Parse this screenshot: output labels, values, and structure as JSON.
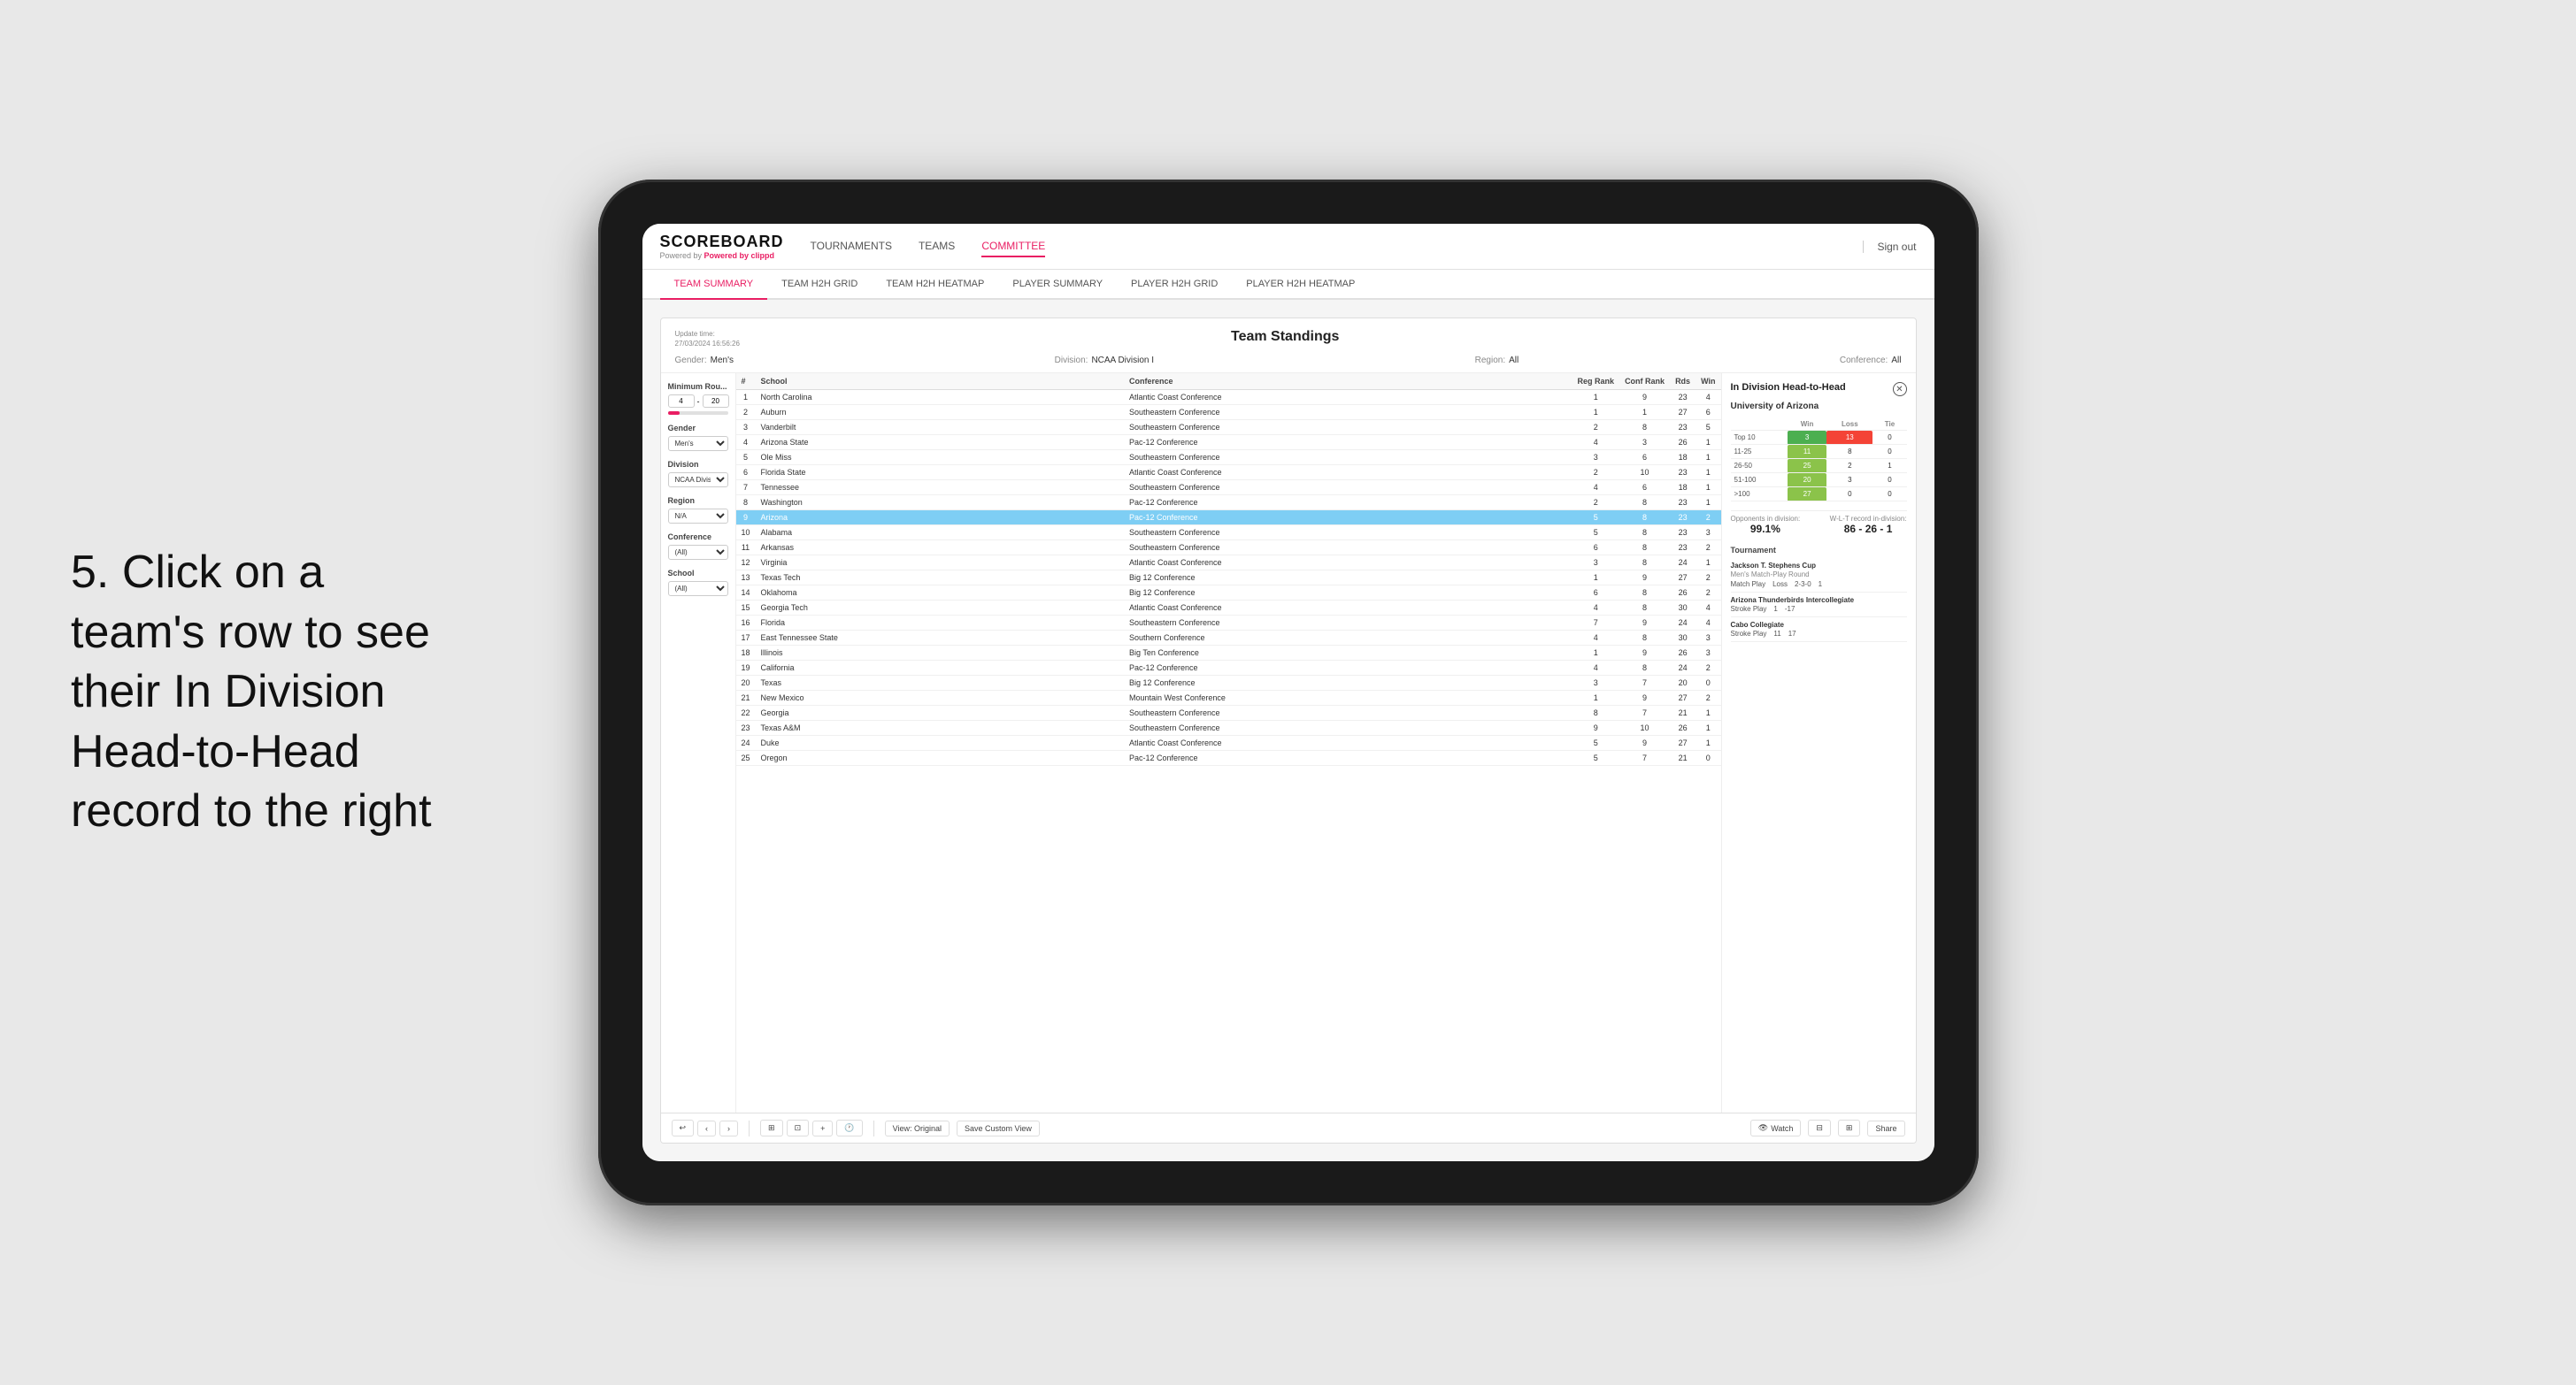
{
  "annotation": {
    "text": "5. Click on a team's row to see their In Division Head-to-Head record to the right"
  },
  "header": {
    "logo_top": "SCOREBOARD",
    "logo_bottom": "Powered by clippd",
    "nav": [
      {
        "label": "TOURNAMENTS",
        "active": false
      },
      {
        "label": "TEAMS",
        "active": false
      },
      {
        "label": "COMMITTEE",
        "active": true
      }
    ],
    "sign_out": "Sign out"
  },
  "sub_nav": [
    {
      "label": "TEAM SUMMARY",
      "active": true
    },
    {
      "label": "TEAM H2H GRID",
      "active": false
    },
    {
      "label": "TEAM H2H HEATMAP",
      "active": false
    },
    {
      "label": "PLAYER SUMMARY",
      "active": false
    },
    {
      "label": "PLAYER H2H GRID",
      "active": false
    },
    {
      "label": "PLAYER H2H HEATMAP",
      "active": false
    }
  ],
  "panel": {
    "title": "Team Standings",
    "update_time": "Update time:\n27/03/2024 16:56:26",
    "gender_label": "Gender:",
    "gender_value": "Men's",
    "division_label": "Division:",
    "division_value": "NCAA Division I",
    "region_label": "Region:",
    "region_value": "All",
    "conference_label": "Conference:",
    "conference_value": "All"
  },
  "filters": {
    "min_rounds_label": "Minimum Rou...",
    "min_rounds_min": "4",
    "min_rounds_max": "20",
    "gender_label": "Gender",
    "gender_value": "Men's",
    "division_label": "Division",
    "division_value": "NCAA Division I",
    "region_label": "Region",
    "region_value": "N/A",
    "conference_label": "Conference",
    "conference_value": "(All)",
    "school_label": "School",
    "school_value": "(All)"
  },
  "table": {
    "headers": [
      "#",
      "School",
      "Conference",
      "Reg Rank",
      "Conf Rank",
      "Rds",
      "Win"
    ],
    "rows": [
      {
        "rank": "1",
        "school": "North Carolina",
        "conference": "Atlantic Coast Conference",
        "reg": "1",
        "conf": "9",
        "rds": "23",
        "win": "4"
      },
      {
        "rank": "2",
        "school": "Auburn",
        "conference": "Southeastern Conference",
        "reg": "1",
        "conf": "1",
        "rds": "27",
        "win": "6"
      },
      {
        "rank": "3",
        "school": "Vanderbilt",
        "conference": "Southeastern Conference",
        "reg": "2",
        "conf": "8",
        "rds": "23",
        "win": "5"
      },
      {
        "rank": "4",
        "school": "Arizona State",
        "conference": "Pac-12 Conference",
        "reg": "4",
        "conf": "3",
        "rds": "26",
        "win": "1"
      },
      {
        "rank": "5",
        "school": "Ole Miss",
        "conference": "Southeastern Conference",
        "reg": "3",
        "conf": "6",
        "rds": "18",
        "win": "1"
      },
      {
        "rank": "6",
        "school": "Florida State",
        "conference": "Atlantic Coast Conference",
        "reg": "2",
        "conf": "10",
        "rds": "23",
        "win": "1"
      },
      {
        "rank": "7",
        "school": "Tennessee",
        "conference": "Southeastern Conference",
        "reg": "4",
        "conf": "6",
        "rds": "18",
        "win": "1"
      },
      {
        "rank": "8",
        "school": "Washington",
        "conference": "Pac-12 Conference",
        "reg": "2",
        "conf": "8",
        "rds": "23",
        "win": "1"
      },
      {
        "rank": "9",
        "school": "Arizona",
        "conference": "Pac-12 Conference",
        "reg": "5",
        "conf": "8",
        "rds": "23",
        "win": "2",
        "selected": true
      },
      {
        "rank": "10",
        "school": "Alabama",
        "conference": "Southeastern Conference",
        "reg": "5",
        "conf": "8",
        "rds": "23",
        "win": "3"
      },
      {
        "rank": "11",
        "school": "Arkansas",
        "conference": "Southeastern Conference",
        "reg": "6",
        "conf": "8",
        "rds": "23",
        "win": "2"
      },
      {
        "rank": "12",
        "school": "Virginia",
        "conference": "Atlantic Coast Conference",
        "reg": "3",
        "conf": "8",
        "rds": "24",
        "win": "1"
      },
      {
        "rank": "13",
        "school": "Texas Tech",
        "conference": "Big 12 Conference",
        "reg": "1",
        "conf": "9",
        "rds": "27",
        "win": "2"
      },
      {
        "rank": "14",
        "school": "Oklahoma",
        "conference": "Big 12 Conference",
        "reg": "6",
        "conf": "8",
        "rds": "26",
        "win": "2"
      },
      {
        "rank": "15",
        "school": "Georgia Tech",
        "conference": "Atlantic Coast Conference",
        "reg": "4",
        "conf": "8",
        "rds": "30",
        "win": "4"
      },
      {
        "rank": "16",
        "school": "Florida",
        "conference": "Southeastern Conference",
        "reg": "7",
        "conf": "9",
        "rds": "24",
        "win": "4"
      },
      {
        "rank": "17",
        "school": "East Tennessee State",
        "conference": "Southern Conference",
        "reg": "4",
        "conf": "8",
        "rds": "30",
        "win": "3"
      },
      {
        "rank": "18",
        "school": "Illinois",
        "conference": "Big Ten Conference",
        "reg": "1",
        "conf": "9",
        "rds": "26",
        "win": "3"
      },
      {
        "rank": "19",
        "school": "California",
        "conference": "Pac-12 Conference",
        "reg": "4",
        "conf": "8",
        "rds": "24",
        "win": "2"
      },
      {
        "rank": "20",
        "school": "Texas",
        "conference": "Big 12 Conference",
        "reg": "3",
        "conf": "7",
        "rds": "20",
        "win": "0"
      },
      {
        "rank": "21",
        "school": "New Mexico",
        "conference": "Mountain West Conference",
        "reg": "1",
        "conf": "9",
        "rds": "27",
        "win": "2"
      },
      {
        "rank": "22",
        "school": "Georgia",
        "conference": "Southeastern Conference",
        "reg": "8",
        "conf": "7",
        "rds": "21",
        "win": "1"
      },
      {
        "rank": "23",
        "school": "Texas A&M",
        "conference": "Southeastern Conference",
        "reg": "9",
        "conf": "10",
        "rds": "26",
        "win": "1"
      },
      {
        "rank": "24",
        "school": "Duke",
        "conference": "Atlantic Coast Conference",
        "reg": "5",
        "conf": "9",
        "rds": "27",
        "win": "1"
      },
      {
        "rank": "25",
        "school": "Oregon",
        "conference": "Pac-12 Conference",
        "reg": "5",
        "conf": "7",
        "rds": "21",
        "win": "0"
      }
    ]
  },
  "h2h": {
    "title": "In Division Head-to-Head",
    "school": "University of Arizona",
    "record_headers": [
      "",
      "Win",
      "Loss",
      "Tie"
    ],
    "record_rows": [
      {
        "label": "Top 10",
        "win": "3",
        "loss": "13",
        "tie": "0",
        "win_class": "cell-green",
        "loss_class": "cell-red"
      },
      {
        "label": "11-25",
        "win": "11",
        "loss": "8",
        "tie": "0",
        "win_class": "cell-lightgreen",
        "loss_class": ""
      },
      {
        "label": "26-50",
        "win": "25",
        "loss": "2",
        "tie": "1",
        "win_class": "cell-lightgreen",
        "loss_class": ""
      },
      {
        "label": "51-100",
        "win": "20",
        "loss": "3",
        "tie": "0",
        "win_class": "cell-lightgreen",
        "loss_class": ""
      },
      {
        "label": ">100",
        "win": "27",
        "loss": "0",
        "tie": "0",
        "win_class": "cell-lightgreen",
        "loss_class": ""
      }
    ],
    "opponents_label": "Opponents in division:",
    "opponents_value": "99.1%",
    "record_label": "W-L-T record in-division:",
    "record_value": "86 - 26 - 1",
    "tournaments": [
      {
        "name": "Jackson T. Stephens Cup",
        "sub": "Men's Match-Play Round",
        "event_type": "Match Play",
        "result": "Loss",
        "pos": "2-3-0",
        "score": "1"
      },
      {
        "name": "Arizona Thunderbirds Intercollegiate",
        "sub": "",
        "event_type": "Stroke Play",
        "result": "1",
        "pos": "",
        "score": "-17"
      },
      {
        "name": "Cabo Collegiate",
        "sub": "",
        "event_type": "Stroke Play",
        "result": "11",
        "pos": "",
        "score": "17"
      }
    ]
  },
  "toolbar": {
    "undo": "↩",
    "redo": "↪",
    "forward": "⟩",
    "view_original": "View: Original",
    "save_custom": "Save Custom View",
    "watch": "Watch",
    "share": "Share"
  }
}
